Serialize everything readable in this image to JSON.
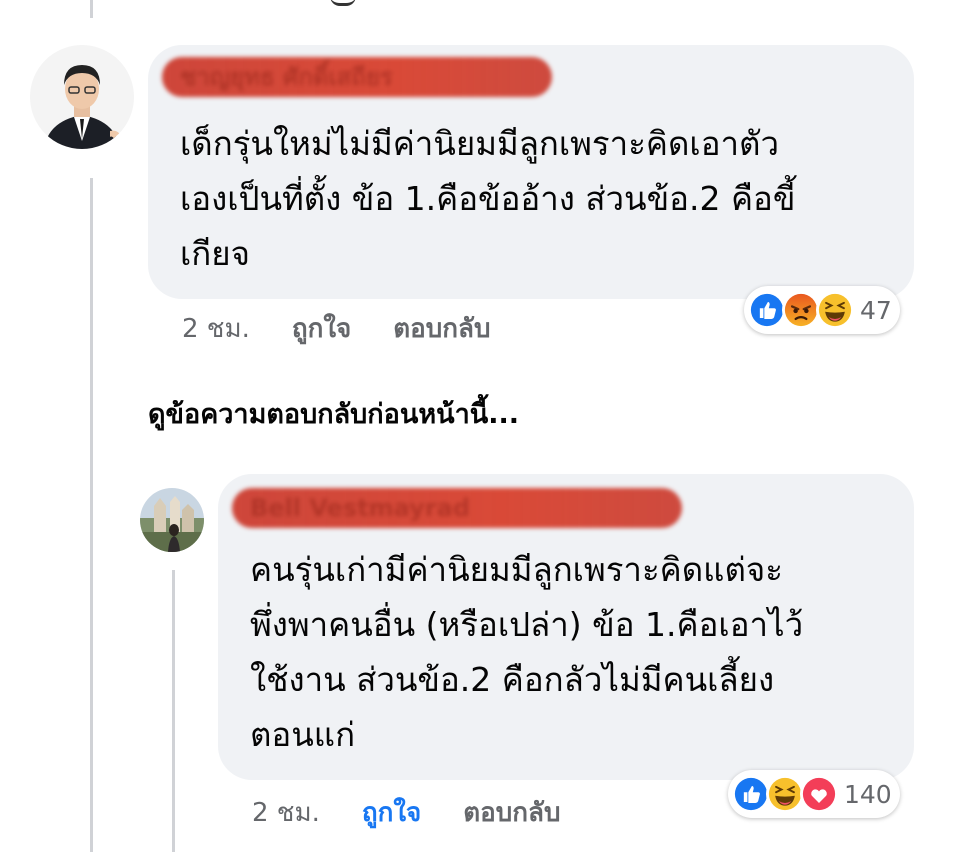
{
  "comment": {
    "author_name": "ชาญยุทธ ศักดิ์เสถียร",
    "text_lines": [
      "เด็กรุ่นใหม่ไม่มีค่านิยมมีลูกเพราะคิดเอาตัว",
      "เองเป็นที่ตั้ง ข้อ 1.คือข้ออ้าง ส่วนข้อ.2 คือขี้",
      "เกียจ"
    ],
    "time": "2 ชม.",
    "like_label": "ถูกใจ",
    "reply_label": "ตอบกลับ",
    "reactions": [
      "like",
      "angry",
      "haha"
    ],
    "reaction_count": "47"
  },
  "view_previous_replies": "ดูข้อความตอบกลับก่อนหน้านี้...",
  "reply": {
    "author_name": "Bell Vestmayrad",
    "text_lines": [
      "คนรุ่นเก่ามีค่านิยมมีลูกเพราะคิดแต่จะ",
      "พึ่งพาคนอื่น (หรือเปล่า) ข้อ 1.คือเอาไว้",
      "ใช้งาน ส่วนข้อ.2 คือกลัวไม่มีคนเลี้ยง",
      "ตอนแก่"
    ],
    "time": "2 ชม.",
    "like_label": "ถูกใจ",
    "reply_label": "ตอบกลับ",
    "reactions": [
      "like",
      "haha",
      "love"
    ],
    "reaction_count": "140"
  },
  "colors": {
    "bubble": "#f0f2f5",
    "meta_text": "#65676b",
    "like_active": "#1877f2",
    "redaction": "#d23a28"
  }
}
